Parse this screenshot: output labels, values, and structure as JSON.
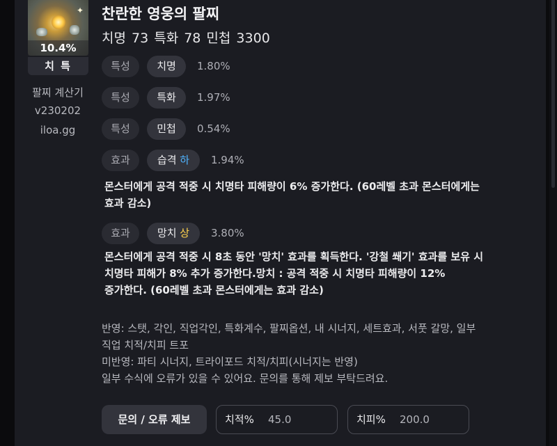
{
  "item": {
    "percent": "10.4%",
    "role": "치 특",
    "title": "찬란한 영웅의 팔찌",
    "stats": "치명 73  특화 78  민첩 3300"
  },
  "sidebar": {
    "line1": "팔찌 계산기",
    "line2": "v230202",
    "line3": "iloa.gg"
  },
  "effects": [
    {
      "category": "특성",
      "name": "치명",
      "value": "1.80%"
    },
    {
      "category": "특성",
      "name": "특화",
      "value": "1.97%"
    },
    {
      "category": "특성",
      "name": "민첩",
      "value": "0.54%"
    },
    {
      "category": "효과",
      "name": "습격",
      "level": "하",
      "value": "1.94%",
      "desc_1": "몬스터에게 공격 적중 시 치명타 피해량이 6% 증가한다. (60레벨 초과 몬스터에게는",
      "desc_2": "효과 감소)"
    },
    {
      "category": "효과",
      "name": "망치",
      "level": "상",
      "value": "3.80%",
      "desc_1": "몬스터에게 공격 적중 시 8초 동안 '망치' 효과를 획득한다. '강철 쐐기' 효과를 보유 시",
      "desc_2": "치명타 피해가 8% 추가 증가한다.망치 : 공격 적중 시 치명타 피해량이 12%",
      "desc_3": "증가한다. (60레벨 초과 몬스터에게는 효과 감소)"
    }
  ],
  "notes": {
    "line1": "반영: 스탯, 각인, 직업각인, 특화계수, 팔찌옵션, 내 시너지, 세트효과, 서풋 갈망, 일부",
    "line2": "직업 치적/치피 트포",
    "line3": "미반영: 파티 시너지, 트라이포드 치적/치피(시너지는 반영)",
    "line4": "일부 수식에 오류가 있을 수 있어요. 문의를 통해 제보 부탁드려요."
  },
  "footer": {
    "report_button": "문의 / 오류 제보",
    "crit_rate_label": "치적%",
    "crit_rate_value": "45.0",
    "crit_dmg_label": "치피%",
    "crit_dmg_value": "200.0"
  },
  "colors": {
    "panel_bg": "#1b1c22",
    "level_low": "#4fb3ff",
    "level_high": "#ffd34d"
  }
}
